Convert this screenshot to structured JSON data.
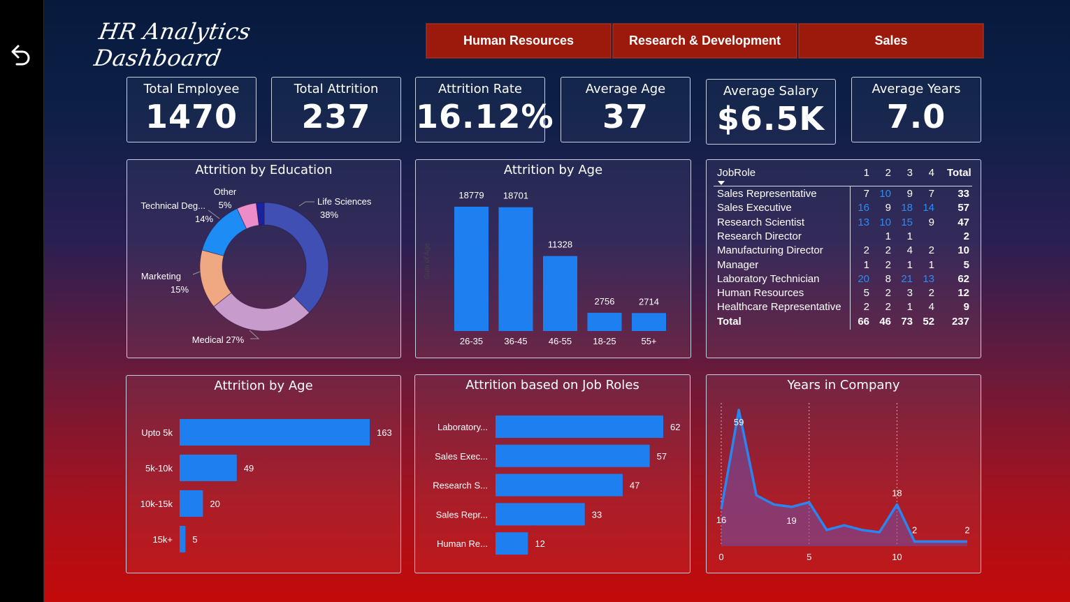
{
  "title": "HR Analytics Dashboard",
  "departments": [
    "Human Resources",
    "Research & Development",
    "Sales"
  ],
  "kpis": [
    {
      "label": "Total Employee",
      "value": "1470"
    },
    {
      "label": "Total Attrition",
      "value": "237"
    },
    {
      "label": "Attrition Rate",
      "value": "16.12%"
    },
    {
      "label": "Average Age",
      "value": "37"
    },
    {
      "label": "Average Salary",
      "value": "$6.5K"
    },
    {
      "label": "Average Years",
      "value": "7.0"
    }
  ],
  "colors": {
    "bar_blue": "#1e7ff0",
    "dept_button": "#9b1a0c"
  },
  "chart_data": [
    {
      "type": "pie",
      "title": "Attrition by Education",
      "slices": [
        {
          "label": "Life Sciences",
          "value": 38,
          "pct_label": "38%",
          "color": "#3f4fb3"
        },
        {
          "label": "Medical",
          "value": 27,
          "pct_label": "27%",
          "color": "#c79ccd"
        },
        {
          "label": "Marketing",
          "value": 15,
          "pct_label": "15%",
          "color": "#f0a882"
        },
        {
          "label": "Technical Deg...",
          "value": 14,
          "pct_label": "14%",
          "color": "#1e8cf5"
        },
        {
          "label": "Other",
          "value": 5,
          "pct_label": "5%",
          "color": "#ec8dc9"
        },
        {
          "label": "",
          "value": 2,
          "pct_label": "",
          "color": "#1a22a0"
        }
      ]
    },
    {
      "type": "bar",
      "title": "Attrition by Age",
      "ylabel": "Sum of Age",
      "categories": [
        "26-35",
        "36-45",
        "46-55",
        "18-25",
        "55+"
      ],
      "values": [
        18779,
        18701,
        11328,
        2756,
        2714
      ],
      "ylim": [
        0,
        20000
      ]
    },
    {
      "type": "bar",
      "title": "Attrition by Age",
      "orientation": "horizontal",
      "categories": [
        "Upto 5k",
        "5k-10k",
        "10k-15k",
        "15k+"
      ],
      "values": [
        163,
        49,
        20,
        5
      ],
      "xlim": [
        0,
        163
      ]
    },
    {
      "type": "bar",
      "title": "Attrition based on Job Roles",
      "orientation": "horizontal",
      "categories": [
        "Laboratory...",
        "Sales Exec...",
        "Research S...",
        "Sales Repr...",
        "Human Re..."
      ],
      "values": [
        62,
        57,
        47,
        33,
        12
      ],
      "xlim": [
        0,
        62
      ]
    },
    {
      "type": "area",
      "title": "Years in Company",
      "x": [
        0,
        1,
        2,
        3,
        4,
        5,
        6,
        7,
        8,
        9,
        10,
        11,
        12,
        13,
        14
      ],
      "y": [
        16,
        59,
        22,
        18,
        17,
        19,
        7,
        9,
        7,
        6,
        18,
        2,
        2,
        2,
        2
      ],
      "point_labels": [
        {
          "x": 0,
          "label": "16"
        },
        {
          "x": 1,
          "label": "59"
        },
        {
          "x": 4,
          "label": "19"
        },
        {
          "x": 10,
          "label": "18"
        },
        {
          "x": 11,
          "label": "2"
        },
        {
          "x": 14,
          "label": "2"
        }
      ],
      "x_ticks": [
        "0",
        "5",
        "10"
      ],
      "ylim": [
        0,
        62
      ],
      "xlim": [
        0,
        14
      ]
    },
    {
      "type": "table",
      "title": "",
      "columns": [
        "JobRole",
        "1",
        "2",
        "3",
        "4",
        "Total"
      ],
      "rows": [
        {
          "role": "Sales Representative",
          "c": [
            "7",
            "10",
            "9",
            "7"
          ],
          "total": "33"
        },
        {
          "role": "Sales Executive",
          "c": [
            "16",
            "9",
            "18",
            "14"
          ],
          "total": "57"
        },
        {
          "role": "Research Scientist",
          "c": [
            "13",
            "10",
            "15",
            "9"
          ],
          "total": "47"
        },
        {
          "role": "Research Director",
          "c": [
            "",
            "1",
            "1",
            ""
          ],
          "total": "2"
        },
        {
          "role": "Manufacturing Director",
          "c": [
            "2",
            "2",
            "4",
            "2"
          ],
          "total": "10"
        },
        {
          "role": "Manager",
          "c": [
            "1",
            "2",
            "1",
            "1"
          ],
          "total": "5"
        },
        {
          "role": "Laboratory Technician",
          "c": [
            "20",
            "8",
            "21",
            "13"
          ],
          "total": "62"
        },
        {
          "role": "Human Resources",
          "c": [
            "5",
            "2",
            "3",
            "2"
          ],
          "total": "12"
        },
        {
          "role": "Healthcare Representative",
          "c": [
            "2",
            "2",
            "1",
            "4"
          ],
          "total": "9"
        }
      ],
      "total_row": {
        "role": "Total",
        "c": [
          "66",
          "46",
          "73",
          "52"
        ],
        "total": "237"
      }
    }
  ]
}
